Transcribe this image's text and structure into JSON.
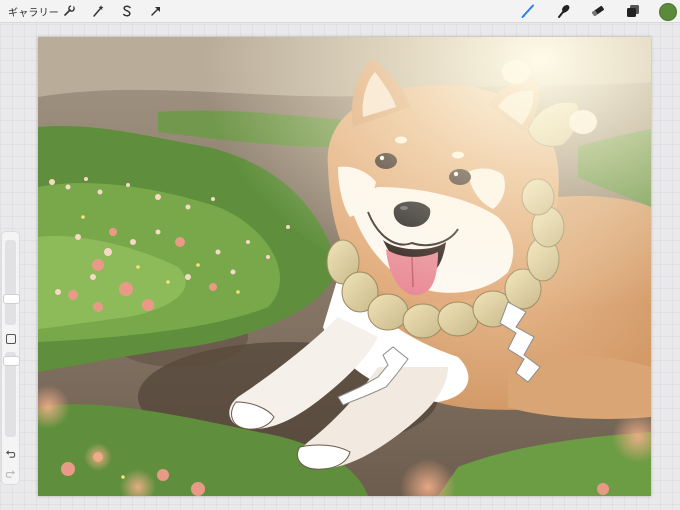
{
  "toolbar": {
    "gallery_label": "ギャラリー",
    "left_tools": [
      "wrench-icon",
      "magic-wand-icon",
      "selection-s-icon",
      "transform-arrow-icon"
    ],
    "right_tools": [
      "brush-icon",
      "smudge-icon",
      "eraser-icon",
      "layers-icon"
    ],
    "active_tool": "brush-icon",
    "active_color": "#5a8a3a",
    "accent_color": "#2a7ee6"
  },
  "sidebar": {
    "items": [
      "brush-size-slider",
      "modify-button",
      "opacity-slider",
      "undo-icon",
      "redo-icon"
    ]
  },
  "artwork": {
    "subject": "shiba-inu",
    "accessory": "shimenawa-rope-with-shide"
  }
}
